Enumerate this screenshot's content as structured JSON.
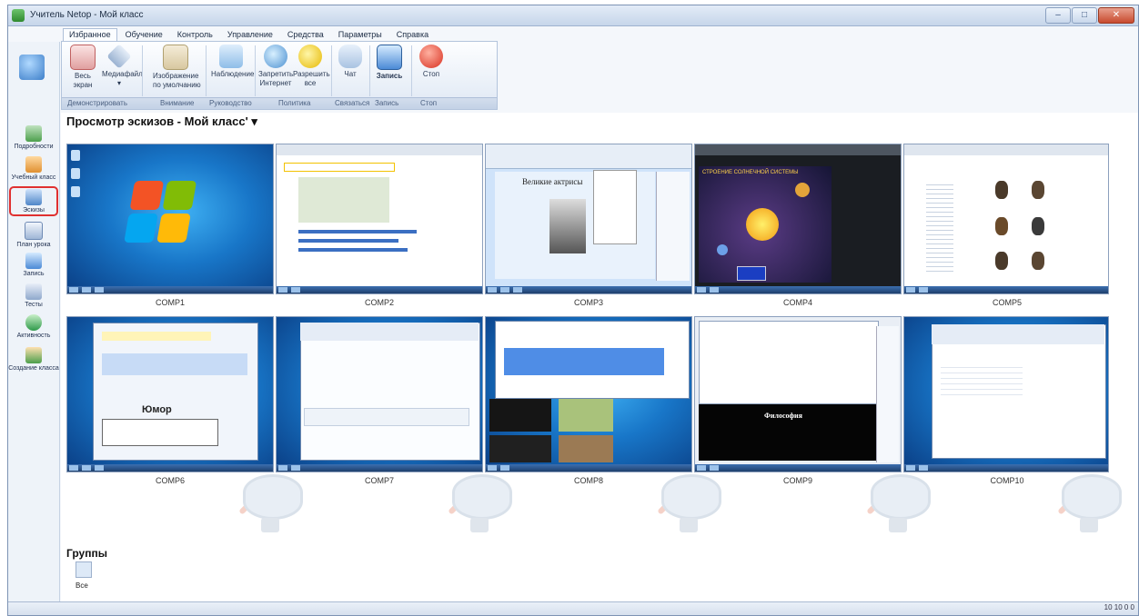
{
  "window": {
    "title": "Учитель Netop - Мой класс",
    "min": "–",
    "max": "□",
    "close": "✕"
  },
  "menu": [
    "Избранное",
    "Обучение",
    "Контроль",
    "Управление",
    "Средства",
    "Параметры",
    "Справка"
  ],
  "ribbon": {
    "buttons": [
      {
        "label1": "Весь",
        "label2": "экран",
        "icon": "fullscreen-icon"
      },
      {
        "label1": "Медиафайл",
        "label2": "▾",
        "icon": "media-icon"
      },
      {
        "label1": "Изображение",
        "label2": "по умолчанию",
        "icon": "image-icon"
      },
      {
        "label1": "Наблюдение",
        "label2": "",
        "icon": "observe-icon"
      },
      {
        "label1": "Запретить",
        "label2": "Интернет",
        "icon": "block-internet-icon"
      },
      {
        "label1": "Разрешить",
        "label2": "все",
        "icon": "allow-all-icon"
      },
      {
        "label1": "Чат",
        "label2": "",
        "icon": "chat-icon"
      },
      {
        "label1": "Запись",
        "label2": "",
        "icon": "record-icon"
      },
      {
        "label1": "Стоп",
        "label2": "",
        "icon": "stop-icon"
      }
    ],
    "groups": [
      "Демонстрировать",
      "Внимание",
      "Руководство",
      "Политика",
      "Связаться",
      "Запись",
      "Стоп"
    ]
  },
  "sidebar": [
    {
      "label": "Подробности",
      "icon": "details-icon"
    },
    {
      "label": "Учебный класс",
      "icon": "classroom-icon"
    },
    {
      "label": "Эскизы",
      "icon": "thumbnails-icon"
    },
    {
      "label": "План урока",
      "icon": "lesson-plan-icon"
    },
    {
      "label": "Запись",
      "icon": "record-icon"
    },
    {
      "label": "Тесты",
      "icon": "tests-icon"
    },
    {
      "label": "Активность",
      "icon": "activity-icon"
    },
    {
      "label": "Создание класса",
      "icon": "create-class-icon"
    }
  ],
  "view_title": "Просмотр эскизов - Мой класс' ▾",
  "computers": [
    "COMP1",
    "COMP2",
    "COMP3",
    "COMP4",
    "COMP5",
    "COMP6",
    "COMP7",
    "COMP8",
    "COMP9",
    "COMP10"
  ],
  "screens": {
    "comp3_heading": "Великие актрисы",
    "comp4_heading": "СТРОЕНИЕ СОЛНЕЧНОЙ СИСТЕМЫ",
    "comp6_heading": "Юмор",
    "comp9_heading": "Философия"
  },
  "groups": {
    "title": "Группы",
    "all_label": "Все"
  },
  "status": {
    "text": "10  10  0  0"
  }
}
